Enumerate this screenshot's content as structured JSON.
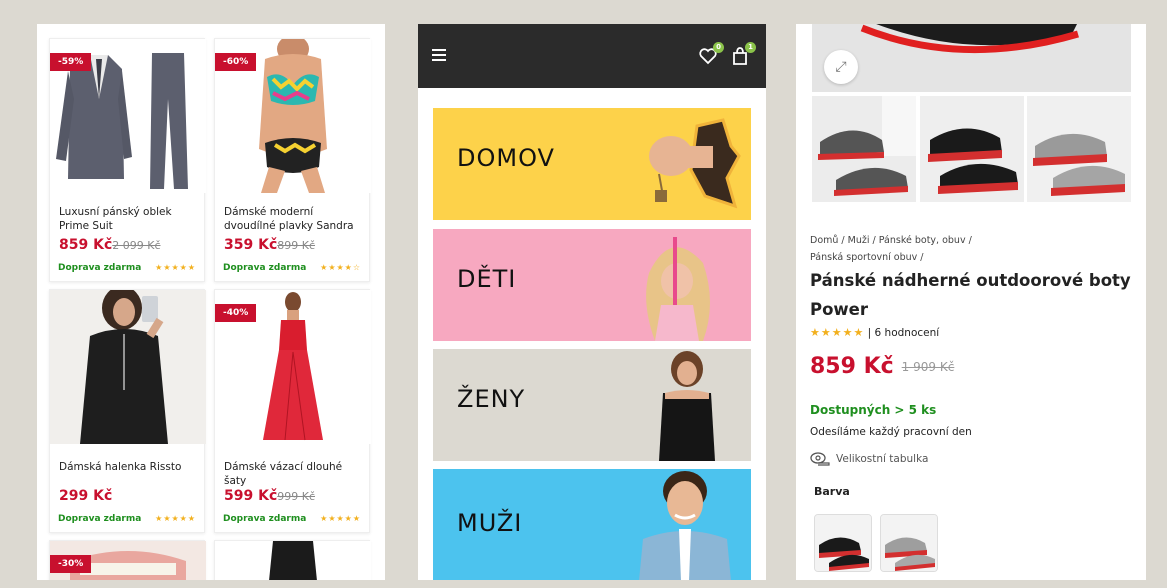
{
  "products": [
    {
      "badge": "-59%",
      "title": "Luxusní pánský oblek Prime Suit",
      "price": "859 Kč",
      "old_price": "2 099 Kč",
      "shipping": "Doprava zdarma",
      "stars": "★★★★★"
    },
    {
      "badge": "-60%",
      "title": "Dámské moderní dvoudílné plavky Sandra",
      "price": "359 Kč",
      "old_price": "899 Kč",
      "shipping": "Doprava zdarma",
      "stars": "★★★★☆"
    },
    {
      "badge": "",
      "title": "Dámská halenka Rissto",
      "price": "299 Kč",
      "old_price": "",
      "shipping": "Doprava zdarma",
      "stars": "★★★★★"
    },
    {
      "badge": "-40%",
      "title": "Dámské vázací dlouhé šaty",
      "price": "599 Kč",
      "old_price": "999 Kč",
      "shipping": "Doprava zdarma",
      "stars": "★★★★★"
    },
    {
      "badge": "-30%"
    }
  ],
  "header": {
    "wishlist_count": "0",
    "cart_count": "1"
  },
  "categories": [
    {
      "label": "DOMOV",
      "color": "#fdd24a"
    },
    {
      "label": "DĚTI",
      "color": "#f7a8c0"
    },
    {
      "label": "ŽENY",
      "color": "#dcd9d1"
    },
    {
      "label": "MUŽI",
      "color": "#4cc3ee"
    }
  ],
  "detail": {
    "breadcrumb_line1": "Domů / Muži / Pánské boty, obuv /",
    "breadcrumb_line2": "Pánská sportovní obuv /",
    "title": "Pánské nádherné outdoorové boty Power",
    "stars": "★★★★★",
    "rating_text": "| 6 hodnocení",
    "price": "859 Kč",
    "old_price": "1 909 Kč",
    "availability": "Dostupných > 5 ks",
    "shipping_note": "Odesíláme každý pracovní den",
    "size_chart": "Velikostní tabulka",
    "color_label": "Barva"
  }
}
